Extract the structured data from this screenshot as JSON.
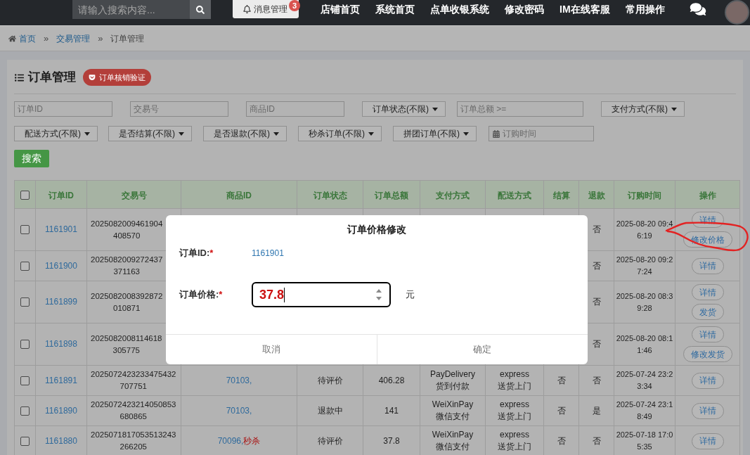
{
  "top_bar": {
    "search": {
      "placeholder": "请输入搜索内容..."
    },
    "messages": {
      "label": "消息管理",
      "badge": "3"
    },
    "links": [
      "店铺首页",
      "系统首页",
      "点单收银系统",
      "修改密码",
      "IM在线客服",
      "常用操作"
    ]
  },
  "breadcrumb": {
    "separator": "»",
    "items": [
      {
        "label": "首页",
        "current": false
      },
      {
        "label": "交易管理",
        "current": false
      },
      {
        "label": "订单管理",
        "current": true
      }
    ]
  },
  "panel": {
    "title": "订单管理",
    "badge": "订单核销验证"
  },
  "filters": [
    [
      {
        "kind": "input",
        "placeholder": "订单ID"
      },
      {
        "kind": "input",
        "placeholder": "交易号"
      },
      {
        "kind": "input",
        "placeholder": "商品ID"
      },
      {
        "kind": "select",
        "value": "订单状态(不限)"
      },
      {
        "kind": "input",
        "placeholder": "订单总额 >="
      },
      {
        "kind": "select",
        "value": "支付方式(不限)"
      }
    ],
    [
      {
        "kind": "select",
        "value": "配送方式(不限)"
      },
      {
        "kind": "select",
        "value": "是否结算(不限)"
      },
      {
        "kind": "select",
        "value": "是否退款(不限)"
      },
      {
        "kind": "select",
        "value": "秒杀订单(不限)"
      },
      {
        "kind": "select",
        "value": "拼团订单(不限)"
      },
      {
        "kind": "date",
        "placeholder": "订购时间"
      }
    ]
  ],
  "search_button": "搜索",
  "table": {
    "select_all": {
      "checked": false
    },
    "columns": [
      "订单ID",
      "交易号",
      "商品ID",
      "订单状态",
      "订单总额",
      "支付方式",
      "配送方式",
      "结算",
      "退款",
      "订购时间",
      "操作"
    ],
    "rows": [
      {
        "checked": false,
        "order_id": "1161901",
        "trade_no": [
          "2025082009461904",
          "408570"
        ],
        "refund": "否",
        "time": [
          "2025-08-20 09:4",
          "6:19"
        ],
        "actions": [
          "详情",
          "修改价格"
        ]
      },
      {
        "checked": false,
        "order_id": "1161900",
        "trade_no": [
          "2025082009272437",
          "371163"
        ],
        "refund": "否",
        "time": [
          "2025-08-20 09:2",
          "7:24"
        ],
        "actions": [
          "详情"
        ]
      },
      {
        "checked": false,
        "order_id": "1161899",
        "trade_no": [
          "2025082008392872",
          "010871"
        ],
        "refund": "否",
        "time": [
          "2025-08-20 08:3",
          "9:28"
        ],
        "actions": [
          "详情",
          "发货"
        ]
      },
      {
        "checked": false,
        "order_id": "1161898",
        "trade_no": [
          "2025082008114618",
          "305775"
        ],
        "refund": "否",
        "time": [
          "2025-08-20 08:1",
          "1:46"
        ],
        "actions": [
          "详情",
          "修改发货"
        ]
      },
      {
        "checked": false,
        "order_id": "1161891",
        "trade_no": [
          "2025072423233475432",
          "707751"
        ],
        "product": {
          "id": "70103,"
        },
        "status": "待评价",
        "total": "406.28",
        "payment": [
          "PayDelivery",
          "货到付款"
        ],
        "delivery": [
          "express",
          "送货上门"
        ],
        "settled": "否",
        "refund": "否",
        "time": [
          "2025-07-24 23:2",
          "3:34"
        ],
        "actions": [
          "详情"
        ]
      },
      {
        "checked": false,
        "order_id": "1161890",
        "trade_no": [
          "2025072423214050853",
          "680865"
        ],
        "product": {
          "id": "70103,"
        },
        "status": "退款中",
        "total": "141",
        "payment": [
          "WeiXinPay",
          "微信支付"
        ],
        "delivery": [
          "express",
          "送货上门"
        ],
        "settled": "否",
        "refund": "是",
        "time": [
          "2025-07-24 23:1",
          "8:49"
        ],
        "actions": [
          "详情"
        ]
      },
      {
        "checked": false,
        "order_id": "1161880",
        "trade_no": [
          "2025071817053513243",
          "266205"
        ],
        "product": {
          "id": "70096,",
          "tag": "秒杀"
        },
        "status": "待评价",
        "total": "37.8",
        "payment": [
          "WeiXinPay",
          "微信支付"
        ],
        "delivery": [
          "express",
          "送货上门"
        ],
        "settled": "否",
        "refund": "否",
        "time": [
          "2025-07-18 17:0",
          "5:35"
        ],
        "actions": [
          "详情"
        ]
      }
    ]
  },
  "dialog": {
    "title": "订单价格修改",
    "fields": [
      {
        "kind": "text",
        "label": "订单ID:",
        "mark": "*",
        "value": "1161901"
      },
      {
        "kind": "number",
        "label": "订单价格:",
        "mark": "*",
        "value": "37.8",
        "unit": "元",
        "focused": true
      }
    ],
    "buttons": [
      "取消",
      "确定"
    ]
  }
}
